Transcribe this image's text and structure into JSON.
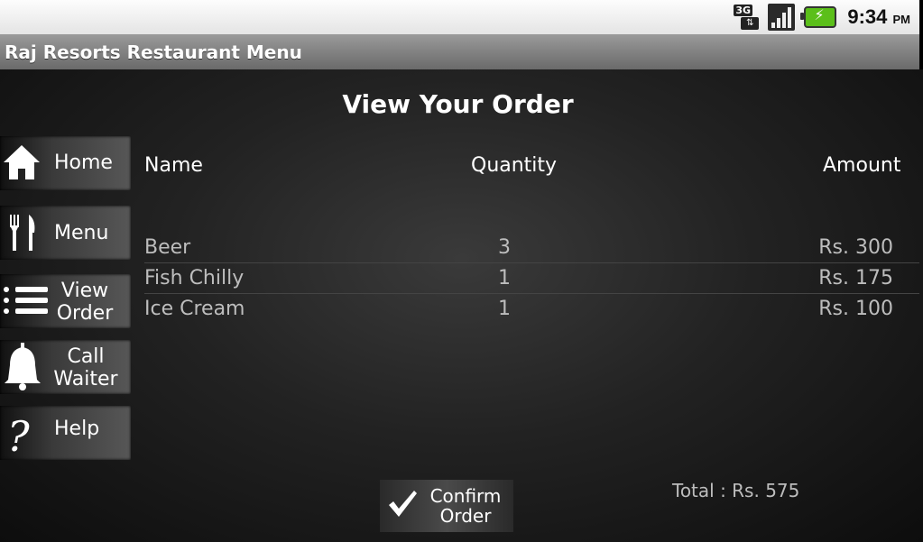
{
  "status_bar": {
    "network_label": "3G",
    "time": "9:34",
    "ampm": "PM",
    "icons": [
      "network-3g-icon",
      "signal-icon",
      "battery-charging-icon"
    ]
  },
  "app_title": "Raj Resorts Restaurant Menu",
  "page_title": "View Your Order",
  "sidebar": {
    "items": [
      {
        "label": "Home",
        "icon": "home-icon"
      },
      {
        "label": "Menu",
        "icon": "fork-knife-icon"
      },
      {
        "label": "View Order",
        "icon": "list-icon"
      },
      {
        "label": "Call Waiter",
        "icon": "bell-icon"
      },
      {
        "label": "Help",
        "icon": "question-icon"
      }
    ]
  },
  "table": {
    "headers": {
      "name": "Name",
      "quantity": "Quantity",
      "amount": "Amount"
    },
    "rows": [
      {
        "name": "Beer",
        "quantity": "3",
        "amount": "Rs. 300"
      },
      {
        "name": "Fish Chilly",
        "quantity": "1",
        "amount": "Rs. 175"
      },
      {
        "name": "Ice Cream",
        "quantity": "1",
        "amount": "Rs. 100"
      }
    ]
  },
  "confirm_button": {
    "label_line1": "Confirm",
    "label_line2": "Order",
    "icon": "check-icon"
  },
  "total_text": "Total : Rs. 575",
  "colors": {
    "battery": "#5bbf1a",
    "row_text": "#bdbdbd"
  }
}
